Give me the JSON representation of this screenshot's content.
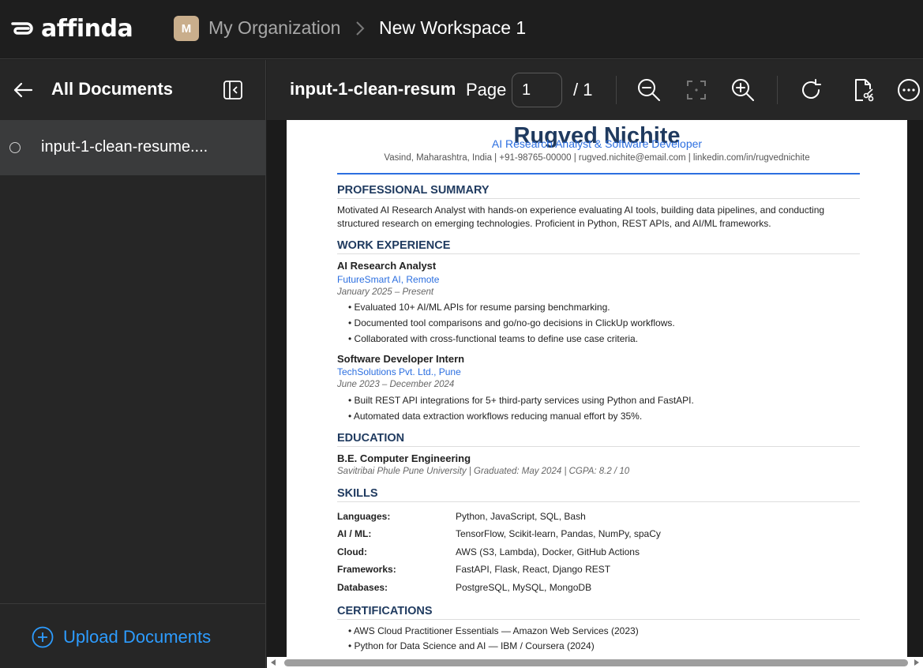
{
  "brand": {
    "name": "affinda"
  },
  "breadcrumb": {
    "org_initial": "M",
    "org": "My Organization",
    "workspace": "New Workspace 1"
  },
  "sidebar": {
    "title": "All Documents",
    "documents": [
      {
        "name": "input-1-clean-resume...."
      }
    ],
    "upload_label": "Upload Documents"
  },
  "toolbar": {
    "doc_name": "input-1-clean-resum",
    "page_label": "Page",
    "page_value": "1",
    "page_total": "/ 1",
    "icons": [
      "zoom-out-icon",
      "fit-page-icon",
      "zoom-in-icon",
      "rotate-icon",
      "split-document-icon",
      "more-options-icon"
    ]
  },
  "resume": {
    "name": "Rugved Nichite",
    "title": "AI Research Analyst & Software Developer",
    "contact": "Vasind, Maharashtra, India | +91-98765-00000 | rugved.nichite@email.com | linkedin.com/in/rugvednichite",
    "summary_heading": "PROFESSIONAL SUMMARY",
    "summary_line1": "Motivated AI Research Analyst with hands-on experience evaluating AI tools, building data pipelines, and conducting",
    "summary_line2": "structured research on emerging technologies. Proficient in Python, REST APIs, and AI/ML frameworks.",
    "work_heading": "WORK EXPERIENCE",
    "jobs": [
      {
        "title": "AI Research Analyst",
        "company": "FutureSmart AI, Remote",
        "dates": "January 2025 – Present",
        "bullets": [
          "• Evaluated 10+ AI/ML APIs for resume parsing benchmarking.",
          "• Documented tool comparisons and go/no-go decisions in ClickUp workflows.",
          "• Collaborated with cross-functional teams to define use case criteria."
        ]
      },
      {
        "title": "Software Developer Intern",
        "company": "TechSolutions Pvt. Ltd., Pune",
        "dates": "June 2023 – December 2024",
        "bullets": [
          "• Built REST API integrations for 5+ third-party services using Python and FastAPI.",
          "• Automated data extraction workflows reducing manual effort by 35%."
        ]
      }
    ],
    "education_heading": "EDUCATION",
    "degree": "B.E. Computer Engineering",
    "school": "Savitribai Phule Pune University | Graduated: May 2024 | CGPA: 8.2 / 10",
    "skills_heading": "SKILLS",
    "skills": [
      {
        "label": "Languages:",
        "value": "Python, JavaScript, SQL, Bash"
      },
      {
        "label": "AI / ML:",
        "value": "TensorFlow, Scikit-learn, Pandas, NumPy, spaCy"
      },
      {
        "label": "Cloud:",
        "value": "AWS (S3, Lambda), Docker, GitHub Actions"
      },
      {
        "label": "Frameworks:",
        "value": "FastAPI, Flask, React, Django REST"
      },
      {
        "label": "Databases:",
        "value": "PostgreSQL, MySQL, MongoDB"
      }
    ],
    "cert_heading": "CERTIFICATIONS",
    "certs": [
      "• AWS Cloud Practitioner Essentials — Amazon Web Services (2023)",
      "• Python for Data Science and AI — IBM / Coursera (2024)"
    ]
  },
  "colors": {
    "accent_blue": "#2c6fe0",
    "link_blue": "#2d9cff",
    "heading_navy": "#1f3a5f",
    "org_badge": "#c9ae8c"
  }
}
